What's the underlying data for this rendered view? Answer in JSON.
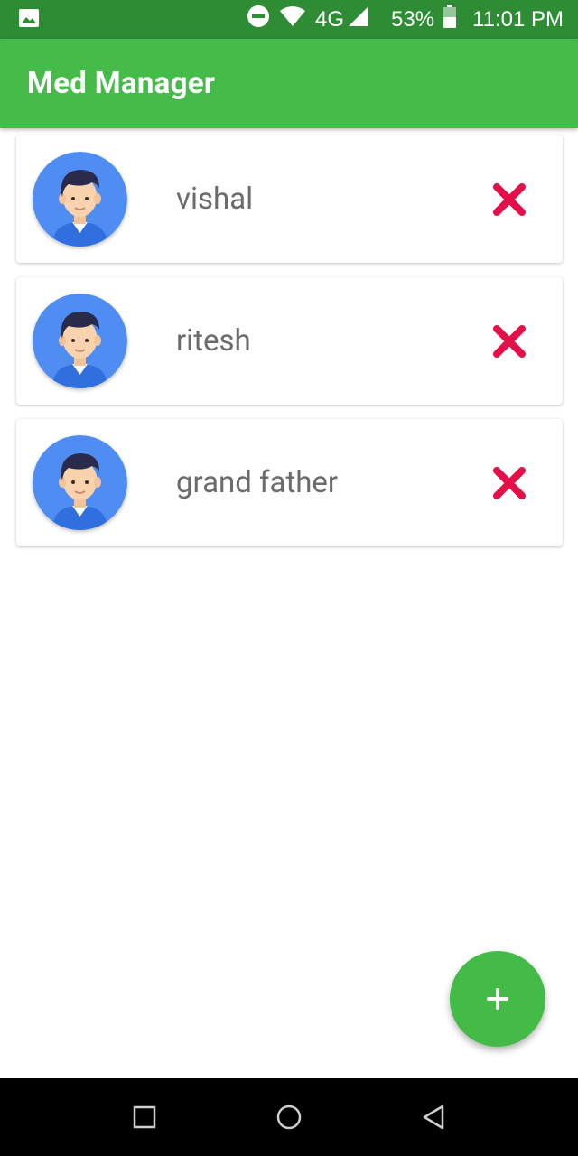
{
  "status_bar": {
    "battery": "53%",
    "network": "4G",
    "time": "11:01 PM",
    "icons": [
      "image-icon",
      "dnd-icon",
      "wifi-icon",
      "signal-icon",
      "battery-icon"
    ]
  },
  "app_bar": {
    "title": "Med Manager"
  },
  "members": [
    {
      "name": "vishal"
    },
    {
      "name": "ritesh"
    },
    {
      "name": "grand father"
    }
  ],
  "fab": {
    "icon": "plus-icon"
  },
  "nav_bar": {
    "icons": [
      "recents-icon",
      "home-icon",
      "back-icon"
    ]
  },
  "colors": {
    "status_bar": "#2e8c35",
    "app_bar": "#45bc4a",
    "fab": "#44bb47",
    "remove": "#e3104a",
    "avatar_bg": "#4f8df2",
    "name_text": "#6b6b6b"
  }
}
